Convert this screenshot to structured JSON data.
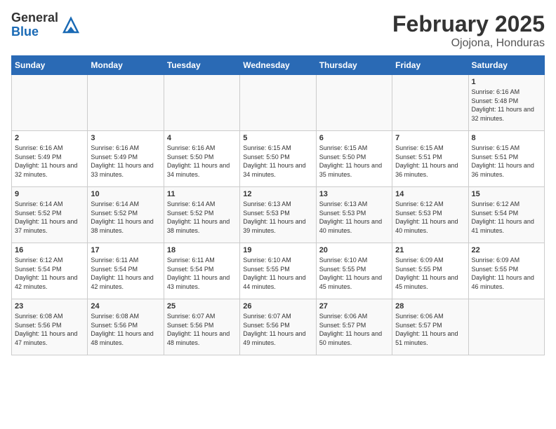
{
  "header": {
    "logo_general": "General",
    "logo_blue": "Blue",
    "title": "February 2025",
    "subtitle": "Ojojona, Honduras"
  },
  "weekdays": [
    "Sunday",
    "Monday",
    "Tuesday",
    "Wednesday",
    "Thursday",
    "Friday",
    "Saturday"
  ],
  "weeks": [
    [
      {
        "day": "",
        "info": ""
      },
      {
        "day": "",
        "info": ""
      },
      {
        "day": "",
        "info": ""
      },
      {
        "day": "",
        "info": ""
      },
      {
        "day": "",
        "info": ""
      },
      {
        "day": "",
        "info": ""
      },
      {
        "day": "1",
        "info": "Sunrise: 6:16 AM\nSunset: 5:48 PM\nDaylight: 11 hours and 32 minutes."
      }
    ],
    [
      {
        "day": "2",
        "info": "Sunrise: 6:16 AM\nSunset: 5:49 PM\nDaylight: 11 hours and 32 minutes."
      },
      {
        "day": "3",
        "info": "Sunrise: 6:16 AM\nSunset: 5:49 PM\nDaylight: 11 hours and 33 minutes."
      },
      {
        "day": "4",
        "info": "Sunrise: 6:16 AM\nSunset: 5:50 PM\nDaylight: 11 hours and 34 minutes."
      },
      {
        "day": "5",
        "info": "Sunrise: 6:15 AM\nSunset: 5:50 PM\nDaylight: 11 hours and 34 minutes."
      },
      {
        "day": "6",
        "info": "Sunrise: 6:15 AM\nSunset: 5:50 PM\nDaylight: 11 hours and 35 minutes."
      },
      {
        "day": "7",
        "info": "Sunrise: 6:15 AM\nSunset: 5:51 PM\nDaylight: 11 hours and 36 minutes."
      },
      {
        "day": "8",
        "info": "Sunrise: 6:15 AM\nSunset: 5:51 PM\nDaylight: 11 hours and 36 minutes."
      }
    ],
    [
      {
        "day": "9",
        "info": "Sunrise: 6:14 AM\nSunset: 5:52 PM\nDaylight: 11 hours and 37 minutes."
      },
      {
        "day": "10",
        "info": "Sunrise: 6:14 AM\nSunset: 5:52 PM\nDaylight: 11 hours and 38 minutes."
      },
      {
        "day": "11",
        "info": "Sunrise: 6:14 AM\nSunset: 5:52 PM\nDaylight: 11 hours and 38 minutes."
      },
      {
        "day": "12",
        "info": "Sunrise: 6:13 AM\nSunset: 5:53 PM\nDaylight: 11 hours and 39 minutes."
      },
      {
        "day": "13",
        "info": "Sunrise: 6:13 AM\nSunset: 5:53 PM\nDaylight: 11 hours and 40 minutes."
      },
      {
        "day": "14",
        "info": "Sunrise: 6:12 AM\nSunset: 5:53 PM\nDaylight: 11 hours and 40 minutes."
      },
      {
        "day": "15",
        "info": "Sunrise: 6:12 AM\nSunset: 5:54 PM\nDaylight: 11 hours and 41 minutes."
      }
    ],
    [
      {
        "day": "16",
        "info": "Sunrise: 6:12 AM\nSunset: 5:54 PM\nDaylight: 11 hours and 42 minutes."
      },
      {
        "day": "17",
        "info": "Sunrise: 6:11 AM\nSunset: 5:54 PM\nDaylight: 11 hours and 42 minutes."
      },
      {
        "day": "18",
        "info": "Sunrise: 6:11 AM\nSunset: 5:54 PM\nDaylight: 11 hours and 43 minutes."
      },
      {
        "day": "19",
        "info": "Sunrise: 6:10 AM\nSunset: 5:55 PM\nDaylight: 11 hours and 44 minutes."
      },
      {
        "day": "20",
        "info": "Sunrise: 6:10 AM\nSunset: 5:55 PM\nDaylight: 11 hours and 45 minutes."
      },
      {
        "day": "21",
        "info": "Sunrise: 6:09 AM\nSunset: 5:55 PM\nDaylight: 11 hours and 45 minutes."
      },
      {
        "day": "22",
        "info": "Sunrise: 6:09 AM\nSunset: 5:55 PM\nDaylight: 11 hours and 46 minutes."
      }
    ],
    [
      {
        "day": "23",
        "info": "Sunrise: 6:08 AM\nSunset: 5:56 PM\nDaylight: 11 hours and 47 minutes."
      },
      {
        "day": "24",
        "info": "Sunrise: 6:08 AM\nSunset: 5:56 PM\nDaylight: 11 hours and 48 minutes."
      },
      {
        "day": "25",
        "info": "Sunrise: 6:07 AM\nSunset: 5:56 PM\nDaylight: 11 hours and 48 minutes."
      },
      {
        "day": "26",
        "info": "Sunrise: 6:07 AM\nSunset: 5:56 PM\nDaylight: 11 hours and 49 minutes."
      },
      {
        "day": "27",
        "info": "Sunrise: 6:06 AM\nSunset: 5:57 PM\nDaylight: 11 hours and 50 minutes."
      },
      {
        "day": "28",
        "info": "Sunrise: 6:06 AM\nSunset: 5:57 PM\nDaylight: 11 hours and 51 minutes."
      },
      {
        "day": "",
        "info": ""
      }
    ]
  ]
}
